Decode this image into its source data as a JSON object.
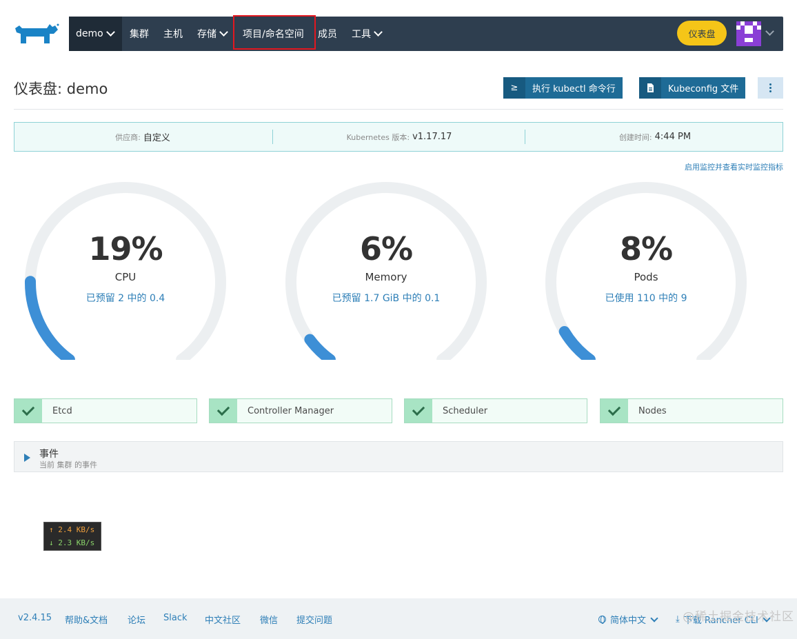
{
  "header": {
    "cluster": "demo",
    "nav": [
      {
        "label": "集群",
        "has_dropdown": false
      },
      {
        "label": "主机",
        "has_dropdown": false
      },
      {
        "label": "存储",
        "has_dropdown": true
      },
      {
        "label": "项目/命名空间",
        "has_dropdown": false,
        "highlighted": true
      },
      {
        "label": "成员",
        "has_dropdown": false
      },
      {
        "label": "工具",
        "has_dropdown": true
      }
    ],
    "dashboard_button": "仪表盘"
  },
  "page": {
    "title": "仪表盘: demo",
    "kubectl_button": "执行 kubectl 命令行",
    "kubectl_icon": "≥",
    "kubeconfig_button": "Kubeconfig 文件"
  },
  "info": {
    "provider_key": "供应商:",
    "provider_val": "自定义",
    "k8s_key": "Kubernetes 版本:",
    "k8s_val": "v1.17.17",
    "created_key": "创建时间:",
    "created_val": "4:44 PM"
  },
  "monitor_link": "启用监控并查看实时监控指标",
  "gauges": [
    {
      "percent_label": "19%",
      "value": 0.19,
      "name": "CPU",
      "sub": "已预留 2 中的 0.4"
    },
    {
      "percent_label": "6%",
      "value": 0.06,
      "name": "Memory",
      "sub": "已预留 1.7 GiB 中的 0.1"
    },
    {
      "percent_label": "8%",
      "value": 0.08,
      "name": "Pods",
      "sub": "已使用 110 中的 9"
    }
  ],
  "components": [
    "Etcd",
    "Controller Manager",
    "Scheduler",
    "Nodes"
  ],
  "events": {
    "title": "事件",
    "subtitle": "当前 集群 的事件"
  },
  "speed": {
    "up": "↑ 2.4 KB/s",
    "down": "↓ 2.3 KB/s"
  },
  "footer": {
    "links": [
      "v2.4.15",
      "帮助&文档",
      "论坛",
      "Slack",
      "中文社区",
      "微信",
      "提交问题"
    ],
    "language": "简体中文",
    "download_cli": "下载 Rancher CLI"
  },
  "watermark": "@稀土掘金技术社区",
  "colors": {
    "navbar": "#2e3e4f",
    "accent_yellow": "#f5c518",
    "primary_blue": "#1e6b96",
    "gauge_fill": "#3d8fd6",
    "gauge_track": "#eceff1",
    "success_green": "#a8e4c4"
  }
}
